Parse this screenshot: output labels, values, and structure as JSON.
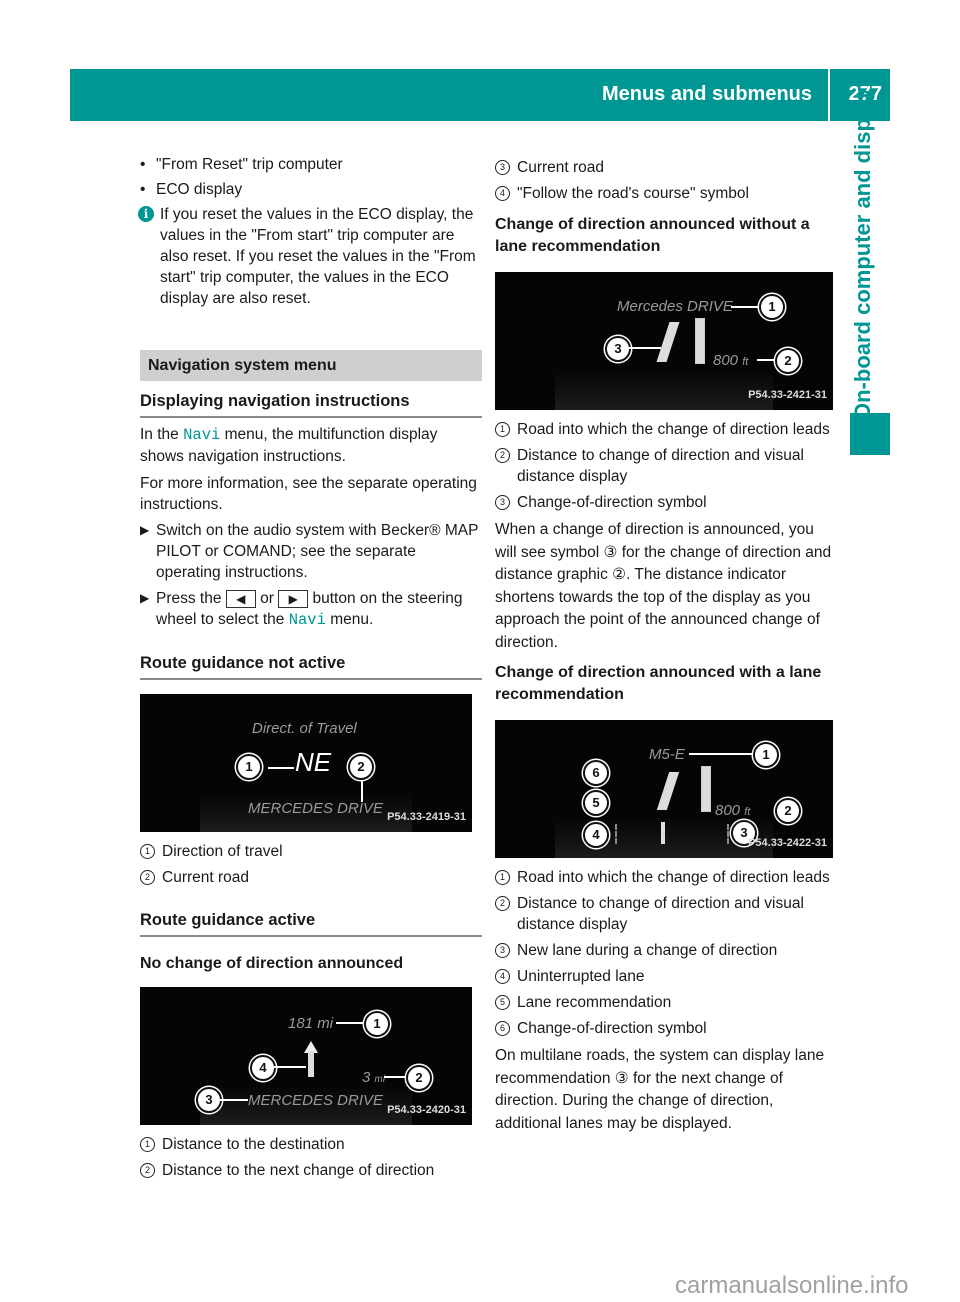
{
  "header": {
    "section_title": "Menus and submenus",
    "page_number": "277"
  },
  "side_tab": {
    "label": "On-board computer and displays"
  },
  "colors": {
    "accent": "#009694",
    "gray_heading": "#cfcfcf"
  },
  "left": {
    "bullets": [
      "\"From Reset\" trip computer",
      "ECO display"
    ],
    "info_icon": "info-icon",
    "info_note": "If you reset the values in the ECO display, the values in the \"From start\" trip computer are also reset. If you reset the values in the \"From start\" trip computer, the values in the ECO display are also reset.",
    "section_heading": "Navigation system menu",
    "heading_displaying": "Displaying navigation instructions",
    "intro_pre": "In the ",
    "navi_label": "Navi",
    "intro_post": " menu, the multifunction display shows navigation instructions.",
    "more_info": "For more information, see the separate operating instructions.",
    "step1": "Switch on the audio system with Becker® MAP PILOT or COMAND; see the separate operating instructions.",
    "step2_pre": "Press the ",
    "key_left": "◀",
    "step2_or": " or ",
    "key_right": "▶",
    "step2_mid": " button on the steering wheel to select the ",
    "step2_post": " menu.",
    "heading_not_active": "Route guidance not active",
    "display1": {
      "title": "Direct. of Travel",
      "direction": "NE",
      "road": "MERCEDES DRIVE",
      "code": "P54.33-2419-31"
    },
    "legend1": [
      {
        "n": "1",
        "text": "Direction of travel"
      },
      {
        "n": "2",
        "text": "Current road"
      }
    ],
    "heading_active": "Route guidance active",
    "heading_no_change": "No change of direction announced",
    "display2": {
      "dest_distance": "181 mi",
      "next_distance": "3",
      "next_unit": "mi",
      "road": "MERCEDES DRIVE",
      "code": "P54.33-2420-31"
    },
    "legend2": [
      {
        "n": "1",
        "text": "Distance to the destination"
      },
      {
        "n": "2",
        "text": "Distance to the next change of direction"
      }
    ]
  },
  "right": {
    "legend2_cont": [
      {
        "n": "3",
        "text": "Current road"
      },
      {
        "n": "4",
        "text": "\"Follow the road's course\" symbol"
      }
    ],
    "heading_without_lane": "Change of direction announced without a lane recommendation",
    "display3": {
      "road": "Mercedes DRIVE",
      "distance": "800",
      "unit": "ft",
      "code": "P54.33-2421-31"
    },
    "legend3": [
      {
        "n": "1",
        "text": "Road into which the change of direction leads"
      },
      {
        "n": "2",
        "text": "Distance to change of direction and visual distance display"
      },
      {
        "n": "3",
        "text": "Change-of-direction symbol"
      }
    ],
    "para_announced": "When a change of direction is announced, you will see symbol ③ for the change of direction and distance graphic ②. The distance indicator shortens towards the top of the display as you approach the point of the announced change of direction.",
    "heading_with_lane": "Change of direction announced with a lane recommendation",
    "display4": {
      "road": "M5-E",
      "distance": "800",
      "unit": "ft",
      "code": "P54.33-2422-31"
    },
    "legend4": [
      {
        "n": "1",
        "text": "Road into which the change of direction leads"
      },
      {
        "n": "2",
        "text": "Distance to change of direction and visual distance display"
      },
      {
        "n": "3",
        "text": "New lane during a change of direction"
      },
      {
        "n": "4",
        "text": "Uninterrupted lane"
      },
      {
        "n": "5",
        "text": "Lane recommendation"
      },
      {
        "n": "6",
        "text": "Change-of-direction symbol"
      }
    ],
    "para_multilane": "On multilane roads, the system can display lane recommendation ③ for the next change of direction. During the change of direction, additional lanes may be displayed."
  },
  "watermark": "carmanualsonline.info"
}
